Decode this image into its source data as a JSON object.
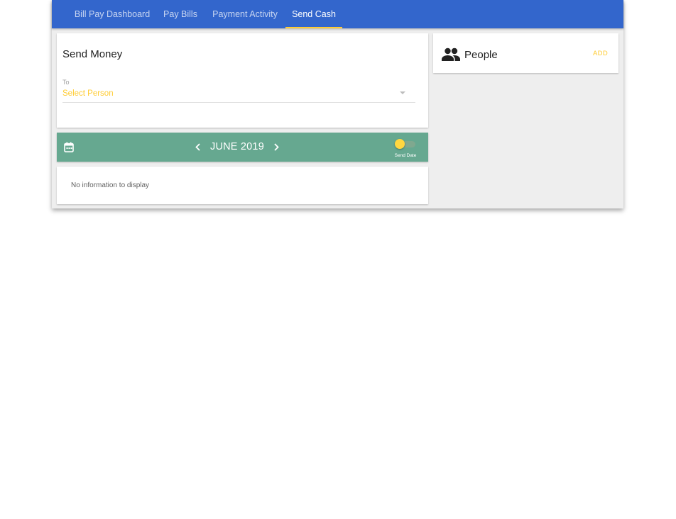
{
  "nav": {
    "tabs": [
      {
        "label": "Bill Pay Dashboard"
      },
      {
        "label": "Pay Bills"
      },
      {
        "label": "Payment Activity"
      },
      {
        "label": "Send Cash",
        "active": true
      }
    ]
  },
  "send_money": {
    "title": "Send Money",
    "to_label": "To",
    "select_value": "Select Person"
  },
  "calendar": {
    "month_label": "JUNE 2019",
    "toggle_label": "Send Date",
    "toggle_on": false,
    "prev_icon": "chevron-left-icon",
    "next_icon": "chevron-right-icon",
    "calendar_icon": "calendar-icon"
  },
  "activity": {
    "empty_text": "No information to display"
  },
  "people": {
    "title": "People",
    "add_label": "ADD",
    "icon": "people-icon"
  },
  "colors": {
    "topbar": "#3366cc",
    "accent": "#ffcc33",
    "calendar_bar": "#66a890",
    "background": "#eeeeee"
  }
}
